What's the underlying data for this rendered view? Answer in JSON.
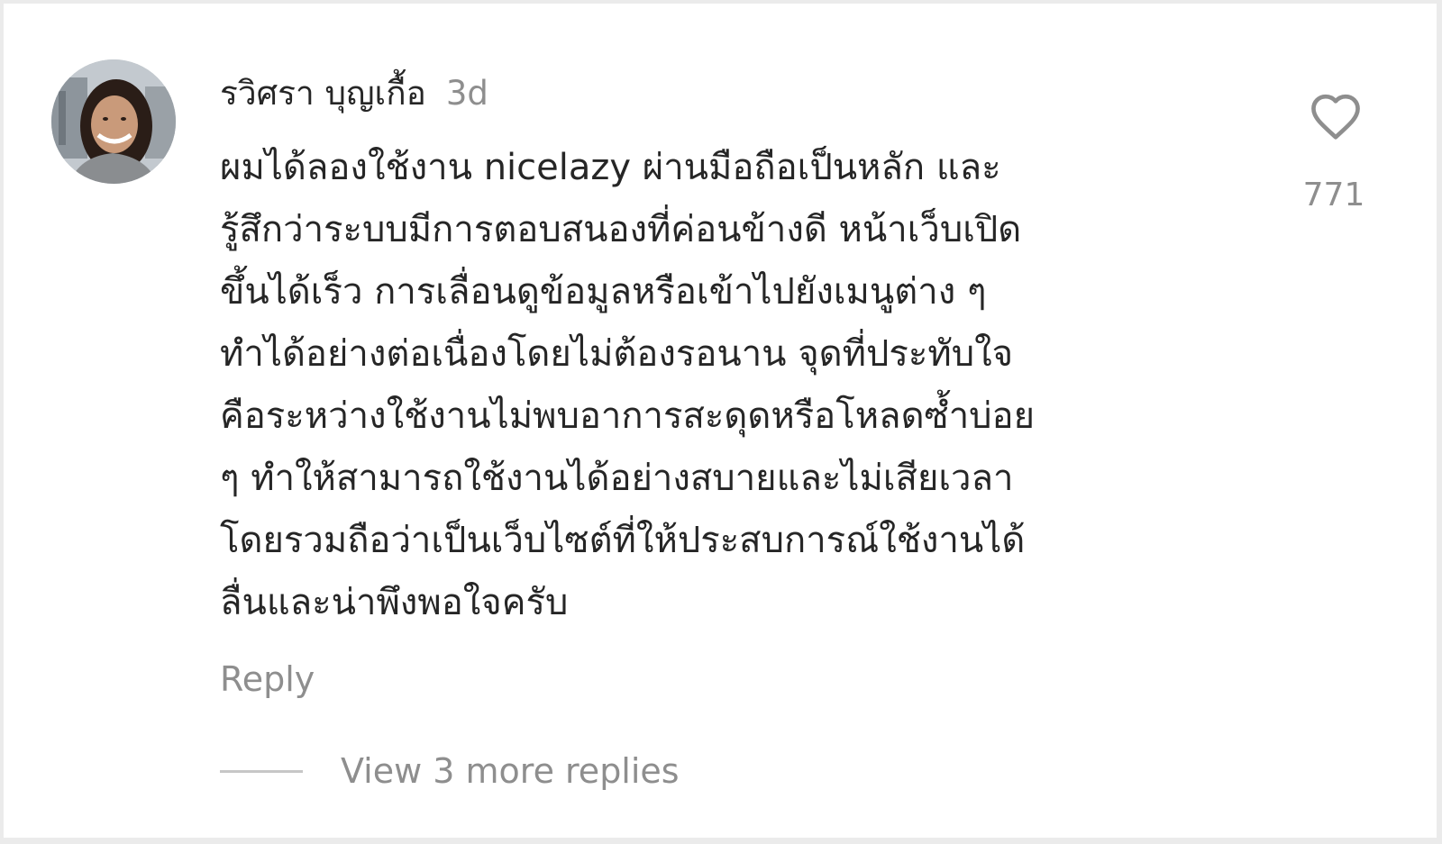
{
  "comment": {
    "username": "รวิศรา บุญเกื้อ",
    "time": "3d",
    "text_lines": [
      "ผมได้ลองใช้งาน nicelazy ผ่านมือถือเป็นหลัก และ",
      "รู้สึกว่าระบบมีการตอบสนองที่ค่อนข้างดี หน้าเว็บเปิด",
      "ขึ้นได้เร็ว การเลื่อนดูข้อมูลหรือเข้าไปยังเมนูต่าง ๆ",
      "ทำได้อย่างต่อเนื่องโดยไม่ต้องรอนาน จุดที่ประทับใจ",
      "คือระหว่างใช้งานไม่พบอาการสะดุดหรือโหลดซ้ำบ่อย",
      "ๆ ทำให้สามารถใช้งานได้อย่างสบายและไม่เสียเวลา",
      "โดยรวมถือว่าเป็นเว็บไซต์ที่ให้ประสบการณ์ใช้งานได้",
      "ลื่นและน่าพึงพอใจครับ"
    ],
    "reply_label": "Reply",
    "view_replies_label": "View 3 more replies",
    "like_icon": "heart-outline-icon",
    "like_count": "771"
  },
  "colors": {
    "primary_text": "#262626",
    "secondary_text": "#8e8e8e",
    "background": "#ffffff"
  }
}
